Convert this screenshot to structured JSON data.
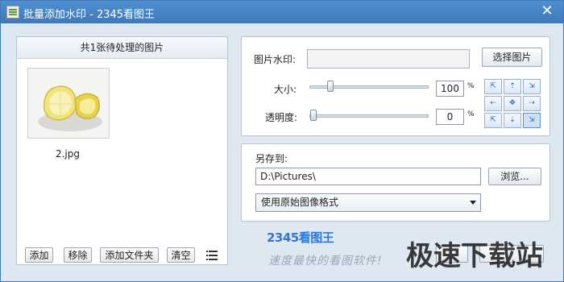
{
  "window": {
    "title": "批量添加水印 - 2345看图王",
    "close_glyph": "✕"
  },
  "left_panel": {
    "header": "共1张待处理的图片",
    "image": {
      "filename": "2.jpg",
      "icon": "lemon-thumbnail"
    },
    "buttons": {
      "add": "添加",
      "remove": "移除",
      "add_folder": "添加文件夹",
      "clear": "清空"
    }
  },
  "watermark_group": {
    "image_label": "图片水印:",
    "select_image_button": "选择图片",
    "size_label": "大小:",
    "size_value": "100",
    "size_unit": "%",
    "size_fraction": 0.15,
    "opacity_label": "透明度:",
    "opacity_value": "0",
    "opacity_unit": "%",
    "opacity_fraction": 0.0,
    "position_grid_selected": 8
  },
  "save_group": {
    "label": "另存到:",
    "path": "D:\\Pictures\\",
    "browse_button": "浏览...",
    "format_select": "使用原始图像格式"
  },
  "footer": {
    "brand": "2345看图王",
    "slogan": "速度最快的看图软件!",
    "watermark_text": "极速下载站"
  },
  "colors": {
    "titlebar": "#3f79b9",
    "brand_blue": "#2f78d2"
  }
}
